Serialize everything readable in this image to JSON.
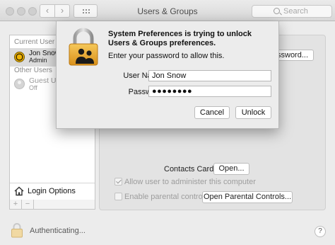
{
  "window": {
    "title": "Users & Groups",
    "search_placeholder": "Search",
    "back": "‹",
    "forward": "›"
  },
  "sidebar": {
    "current_user_heading": "Current User",
    "current_user": {
      "name": "Jon Snow",
      "role": "Admin"
    },
    "other_users_heading": "Other Users",
    "other_users": [
      {
        "name": "Guest User",
        "status": "Off"
      }
    ],
    "login_options_label": "Login Options",
    "plus": "+",
    "minus": "−"
  },
  "main": {
    "password_button_label": "ssword...",
    "contacts_card_label": "Contacts Card:",
    "open_button_label": "Open...",
    "allow_admin_label": "Allow user to administer this computer",
    "allow_admin_checked": true,
    "parental_label": "Enable parental controls",
    "parental_checked": false,
    "parental_button_label": "Open Parental Controls..."
  },
  "footer": {
    "status": "Authenticating...",
    "help": "?"
  },
  "dialog": {
    "title": "System Preferences is trying to unlock Users & Groups preferences.",
    "subtitle": "Enter your password to allow this.",
    "username_label": "User Name:",
    "username_value": "Jon Snow",
    "password_label": "Password:",
    "password_value": "●●●●●●●●",
    "cancel_label": "Cancel",
    "unlock_label": "Unlock"
  },
  "colors": {
    "lock_gold": "#e8a923",
    "selected_row": "#dcdcdc"
  }
}
